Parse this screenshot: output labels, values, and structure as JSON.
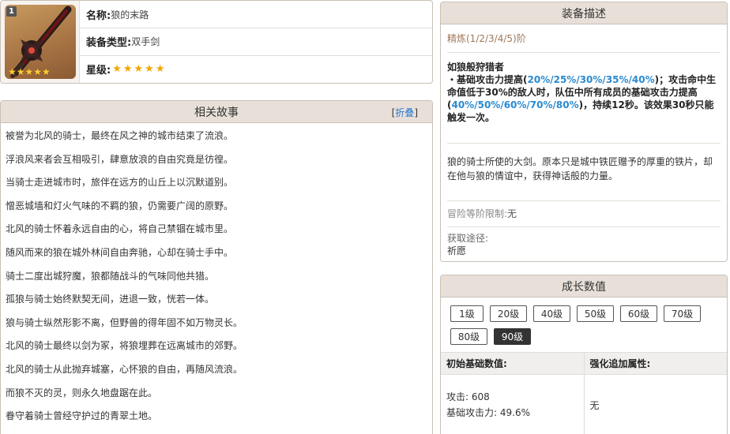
{
  "info": {
    "rank": "1",
    "name_label": "名称:",
    "name_value": "狼的末路",
    "type_label": "装备类型:",
    "type_value": "双手剑",
    "star_label": "星级:",
    "stars": "★★★★★",
    "thumb_stars": "★★★★★"
  },
  "story": {
    "title": "相关故事",
    "fold_open": "[",
    "fold_label": "折叠",
    "fold_close": "]",
    "lines": [
      "被誉为北风的骑士，最终在风之神的城市结束了流浪。",
      "浮浪风来者会互相吸引，肆意放浪的自由究竟是彷徨。",
      "当骑士走进城市时，旅伴在远方的山丘上以沉默道别。",
      "憎恶城墙和灯火气味的不羁的狼，仍需要广阔的原野。",
      "北风的骑士怀着永远自由的心，将自己禁锢在城市里。",
      "随风而来的狼在城外林间自由奔驰，心却在骑士手中。",
      "骑士二度出城狩魔，狼都随战斗的气味同他共猎。",
      "孤狼与骑士始终默契无间，进退一致，恍若一体。",
      "狼与骑士纵然形影不离，但野兽的得年固不如万物灵长。",
      "北风的骑士最终以剑为冢，将狼埋葬在远离城市的郊野。",
      "北风的骑士从此抛弃城塞，心怀狼的自由，再随风流浪。",
      "而狼不灭的灵，则永久地盘踞在此。",
      "眷守着骑士曾经守护过的青翠土地。"
    ]
  },
  "desc": {
    "title": "装备描述",
    "refine": "精炼(1/2/3/4/5)阶",
    "skill_name": "如狼般狩猎者",
    "effect_p1": "・基础攻击力提高(",
    "effect_h1": "20%/25%/30%/35%/40%",
    "effect_p2": ")；攻击命中生命值低于30%的敌人时，队伍中所有成员的基础攻击力提高(",
    "effect_h2": "40%/50%/60%/70%/80%",
    "effect_p3": ")，持续12秒。该效果30秒只能触发一次。",
    "lore": "狼的骑士所使的大剑。原本只是城中铁匠赠予的厚重的铁片，却在他与狼的情谊中，获得神话般的力量。",
    "limit_label": "冒险等阶限制:",
    "limit_value": "无",
    "source_label": "获取途径:",
    "source_value": "祈愿"
  },
  "growth": {
    "title": "成长数值",
    "levels": [
      "1级",
      "20级",
      "40级",
      "50级",
      "60级",
      "70级",
      "80级",
      "90级"
    ],
    "active_level": "90级",
    "base_header": "初始基础数值:",
    "bonus_header": "强化追加属性:",
    "atk_label": "攻击: ",
    "atk_value": "608",
    "pct_label": "基础攻击力: ",
    "pct_value": "49.6%",
    "bonus_value": "无"
  }
}
